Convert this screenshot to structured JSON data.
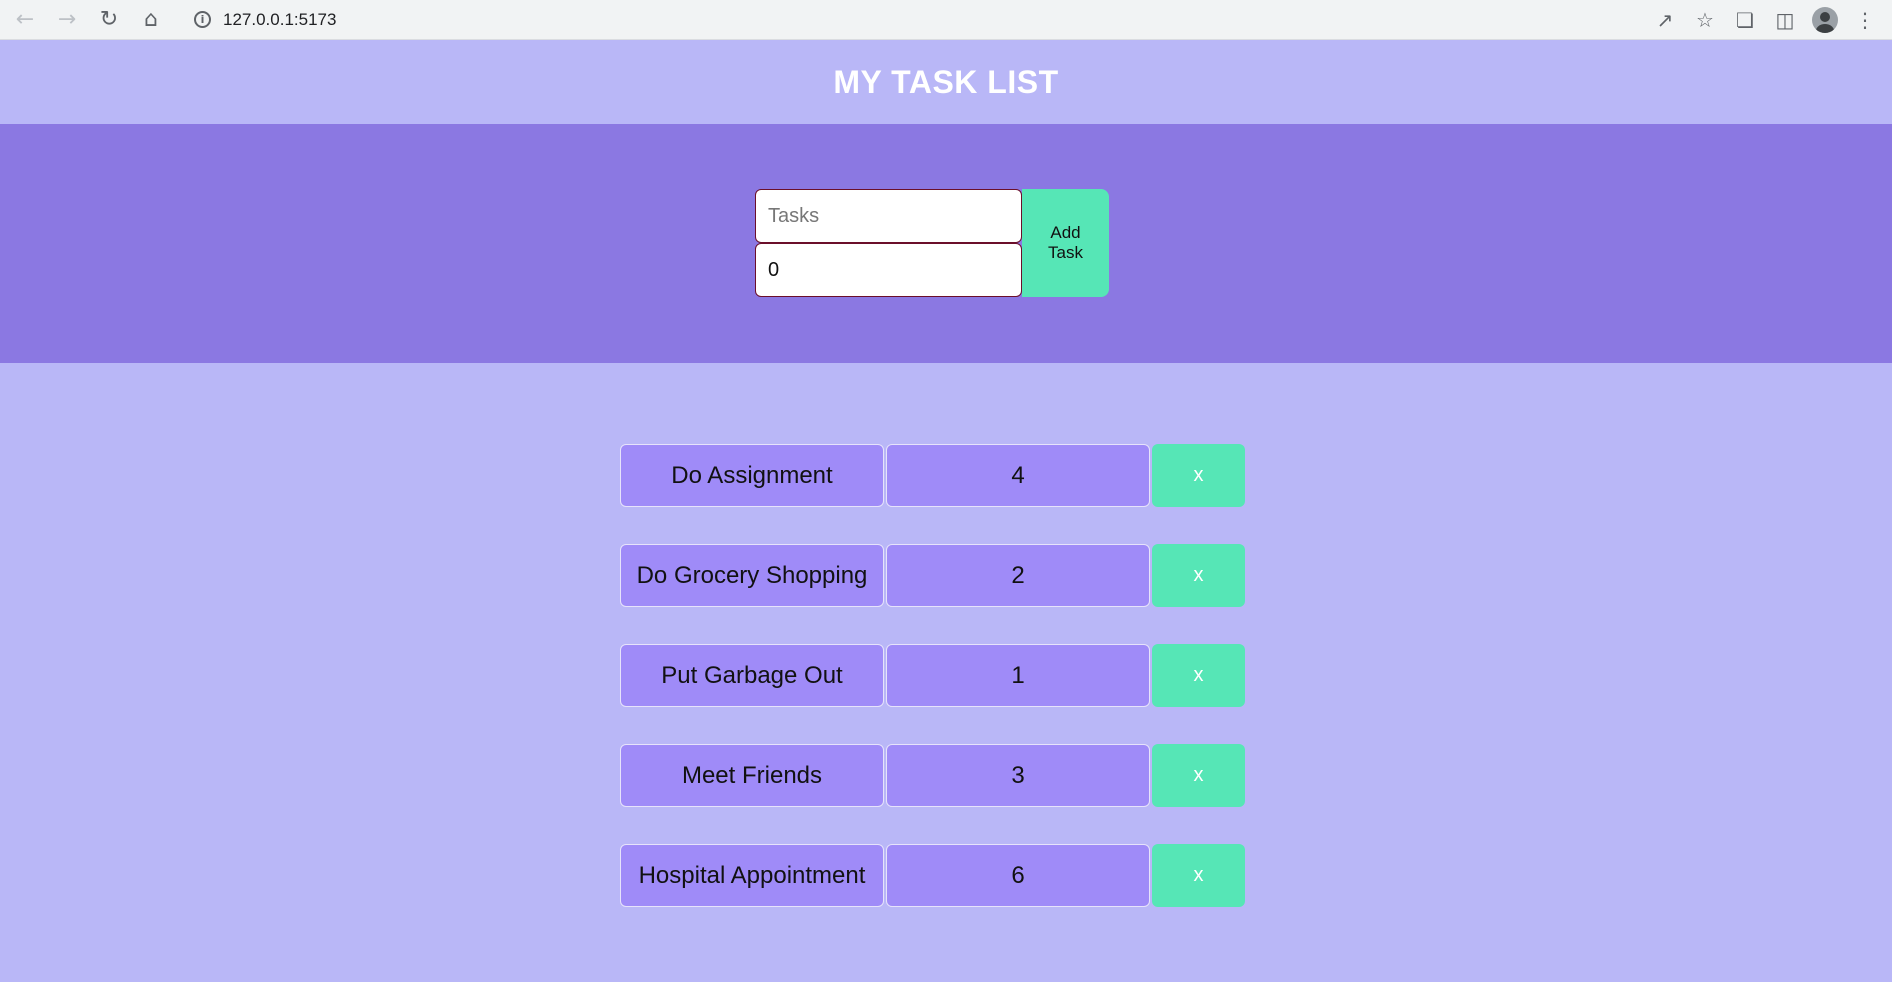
{
  "browser": {
    "url": "127.0.0.1:5173"
  },
  "header": {
    "title": "MY TASK LIST"
  },
  "form": {
    "task_placeholder": "Tasks",
    "priority_value": "0",
    "add_label": "Add Task"
  },
  "tasks": [
    {
      "name": "Do Assignment",
      "value": "4",
      "delete_label": "x"
    },
    {
      "name": "Do Grocery Shopping",
      "value": "2",
      "delete_label": "x"
    },
    {
      "name": "Put Garbage Out",
      "value": "1",
      "delete_label": "x"
    },
    {
      "name": "Meet Friends",
      "value": "3",
      "delete_label": "x"
    },
    {
      "name": "Hospital Appointment",
      "value": "6",
      "delete_label": "x"
    }
  ],
  "colors": {
    "page_bg": "#b9b7f7",
    "form_band_bg": "#8b78e2",
    "task_cell_bg": "#9f8bf8",
    "accent_button": "#56e6b6"
  }
}
